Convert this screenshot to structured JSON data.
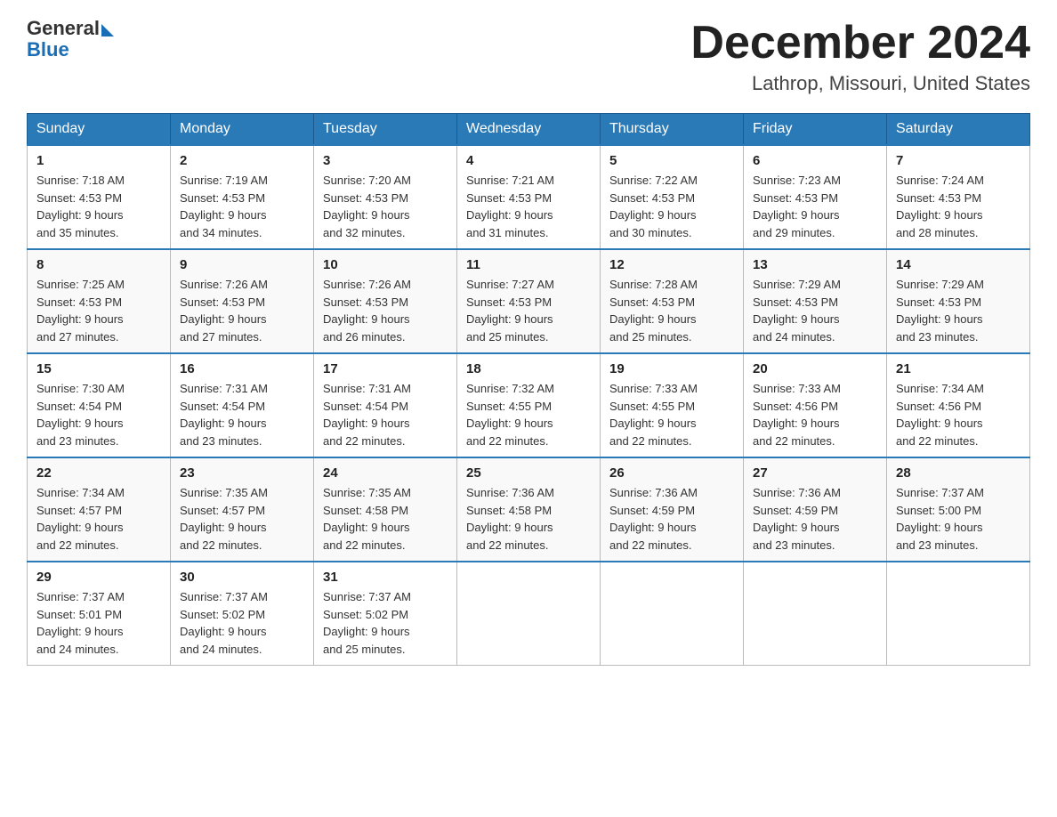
{
  "header": {
    "logo": {
      "text_general": "General",
      "text_blue": "Blue"
    },
    "month_title": "December 2024",
    "location": "Lathrop, Missouri, United States"
  },
  "days_of_week": [
    "Sunday",
    "Monday",
    "Tuesday",
    "Wednesday",
    "Thursday",
    "Friday",
    "Saturday"
  ],
  "weeks": [
    [
      {
        "day": "1",
        "sunrise": "7:18 AM",
        "sunset": "4:53 PM",
        "daylight": "9 hours and 35 minutes."
      },
      {
        "day": "2",
        "sunrise": "7:19 AM",
        "sunset": "4:53 PM",
        "daylight": "9 hours and 34 minutes."
      },
      {
        "day": "3",
        "sunrise": "7:20 AM",
        "sunset": "4:53 PM",
        "daylight": "9 hours and 32 minutes."
      },
      {
        "day": "4",
        "sunrise": "7:21 AM",
        "sunset": "4:53 PM",
        "daylight": "9 hours and 31 minutes."
      },
      {
        "day": "5",
        "sunrise": "7:22 AM",
        "sunset": "4:53 PM",
        "daylight": "9 hours and 30 minutes."
      },
      {
        "day": "6",
        "sunrise": "7:23 AM",
        "sunset": "4:53 PM",
        "daylight": "9 hours and 29 minutes."
      },
      {
        "day": "7",
        "sunrise": "7:24 AM",
        "sunset": "4:53 PM",
        "daylight": "9 hours and 28 minutes."
      }
    ],
    [
      {
        "day": "8",
        "sunrise": "7:25 AM",
        "sunset": "4:53 PM",
        "daylight": "9 hours and 27 minutes."
      },
      {
        "day": "9",
        "sunrise": "7:26 AM",
        "sunset": "4:53 PM",
        "daylight": "9 hours and 27 minutes."
      },
      {
        "day": "10",
        "sunrise": "7:26 AM",
        "sunset": "4:53 PM",
        "daylight": "9 hours and 26 minutes."
      },
      {
        "day": "11",
        "sunrise": "7:27 AM",
        "sunset": "4:53 PM",
        "daylight": "9 hours and 25 minutes."
      },
      {
        "day": "12",
        "sunrise": "7:28 AM",
        "sunset": "4:53 PM",
        "daylight": "9 hours and 25 minutes."
      },
      {
        "day": "13",
        "sunrise": "7:29 AM",
        "sunset": "4:53 PM",
        "daylight": "9 hours and 24 minutes."
      },
      {
        "day": "14",
        "sunrise": "7:29 AM",
        "sunset": "4:53 PM",
        "daylight": "9 hours and 23 minutes."
      }
    ],
    [
      {
        "day": "15",
        "sunrise": "7:30 AM",
        "sunset": "4:54 PM",
        "daylight": "9 hours and 23 minutes."
      },
      {
        "day": "16",
        "sunrise": "7:31 AM",
        "sunset": "4:54 PM",
        "daylight": "9 hours and 23 minutes."
      },
      {
        "day": "17",
        "sunrise": "7:31 AM",
        "sunset": "4:54 PM",
        "daylight": "9 hours and 22 minutes."
      },
      {
        "day": "18",
        "sunrise": "7:32 AM",
        "sunset": "4:55 PM",
        "daylight": "9 hours and 22 minutes."
      },
      {
        "day": "19",
        "sunrise": "7:33 AM",
        "sunset": "4:55 PM",
        "daylight": "9 hours and 22 minutes."
      },
      {
        "day": "20",
        "sunrise": "7:33 AM",
        "sunset": "4:56 PM",
        "daylight": "9 hours and 22 minutes."
      },
      {
        "day": "21",
        "sunrise": "7:34 AM",
        "sunset": "4:56 PM",
        "daylight": "9 hours and 22 minutes."
      }
    ],
    [
      {
        "day": "22",
        "sunrise": "7:34 AM",
        "sunset": "4:57 PM",
        "daylight": "9 hours and 22 minutes."
      },
      {
        "day": "23",
        "sunrise": "7:35 AM",
        "sunset": "4:57 PM",
        "daylight": "9 hours and 22 minutes."
      },
      {
        "day": "24",
        "sunrise": "7:35 AM",
        "sunset": "4:58 PM",
        "daylight": "9 hours and 22 minutes."
      },
      {
        "day": "25",
        "sunrise": "7:36 AM",
        "sunset": "4:58 PM",
        "daylight": "9 hours and 22 minutes."
      },
      {
        "day": "26",
        "sunrise": "7:36 AM",
        "sunset": "4:59 PM",
        "daylight": "9 hours and 22 minutes."
      },
      {
        "day": "27",
        "sunrise": "7:36 AM",
        "sunset": "4:59 PM",
        "daylight": "9 hours and 23 minutes."
      },
      {
        "day": "28",
        "sunrise": "7:37 AM",
        "sunset": "5:00 PM",
        "daylight": "9 hours and 23 minutes."
      }
    ],
    [
      {
        "day": "29",
        "sunrise": "7:37 AM",
        "sunset": "5:01 PM",
        "daylight": "9 hours and 24 minutes."
      },
      {
        "day": "30",
        "sunrise": "7:37 AM",
        "sunset": "5:02 PM",
        "daylight": "9 hours and 24 minutes."
      },
      {
        "day": "31",
        "sunrise": "7:37 AM",
        "sunset": "5:02 PM",
        "daylight": "9 hours and 25 minutes."
      },
      null,
      null,
      null,
      null
    ]
  ],
  "labels": {
    "sunrise": "Sunrise:",
    "sunset": "Sunset:",
    "daylight": "Daylight:"
  }
}
